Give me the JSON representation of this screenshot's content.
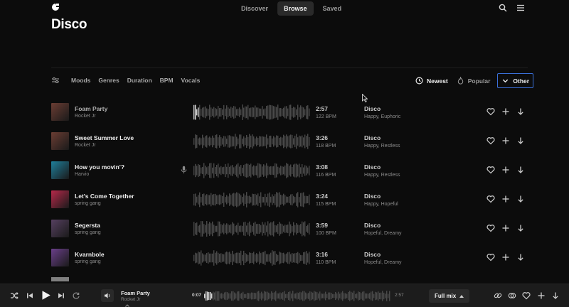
{
  "nav": {
    "tabs": [
      {
        "label": "Discover",
        "active": false
      },
      {
        "label": "Browse",
        "active": true
      },
      {
        "label": "Saved",
        "active": false
      }
    ],
    "icons": [
      "logo-icon",
      "search-icon",
      "menu-icon"
    ]
  },
  "page": {
    "title": "Disco"
  },
  "filters": {
    "items": [
      "Moods",
      "Genres",
      "Duration",
      "BPM",
      "Vocals"
    ]
  },
  "sort": {
    "newest": "Newest",
    "popular": "Popular",
    "other": "Other",
    "active": "Newest"
  },
  "tracks": [
    {
      "title": "Foam Party",
      "artist": "Rocket Jr",
      "length": "2:57",
      "bpm": "122 BPM",
      "genre": "Disco",
      "mood": "Happy, Euphoric",
      "thumb": "#6b3d33",
      "playing": true
    },
    {
      "title": "Sweet Summer Love",
      "artist": "Rocket Jr",
      "length": "3:26",
      "bpm": "118 BPM",
      "genre": "Disco",
      "mood": "Happy, Restless",
      "thumb": "#6b3d33",
      "playing": false
    },
    {
      "title": "How you movin'?",
      "artist": "Harvio",
      "length": "3:08",
      "bpm": "116 BPM",
      "genre": "Disco",
      "mood": "Happy, Restless",
      "thumb": "#1f7f9a",
      "vocals": true,
      "playing": false
    },
    {
      "title": "Let's Come Together",
      "artist": "spring gang",
      "length": "3:24",
      "bpm": "115 BPM",
      "genre": "Disco",
      "mood": "Happy, Hopeful",
      "thumb": "#b6294a",
      "playing": false
    },
    {
      "title": "Segersta",
      "artist": "spring gang",
      "length": "3:59",
      "bpm": "100 BPM",
      "genre": "Disco",
      "mood": "Hopeful, Dreamy",
      "thumb": "#564060",
      "playing": false
    },
    {
      "title": "Kvarnbole",
      "artist": "spring gang",
      "length": "3:16",
      "bpm": "110 BPM",
      "genre": "Disco",
      "mood": "Hopeful, Dreamy",
      "thumb": "#6a3f8a",
      "playing": false
    }
  ],
  "player": {
    "now_playing_title": "Foam Party",
    "now_playing_artist": "Rocket Jr",
    "current_time": "0:07",
    "duration": "2:57",
    "progress": 0.04,
    "mix_label": "Full mix"
  },
  "colors": {
    "background": "#0c0c0c",
    "accent_focus": "#3a6fd8",
    "player_bg": "#1c1c1c"
  }
}
